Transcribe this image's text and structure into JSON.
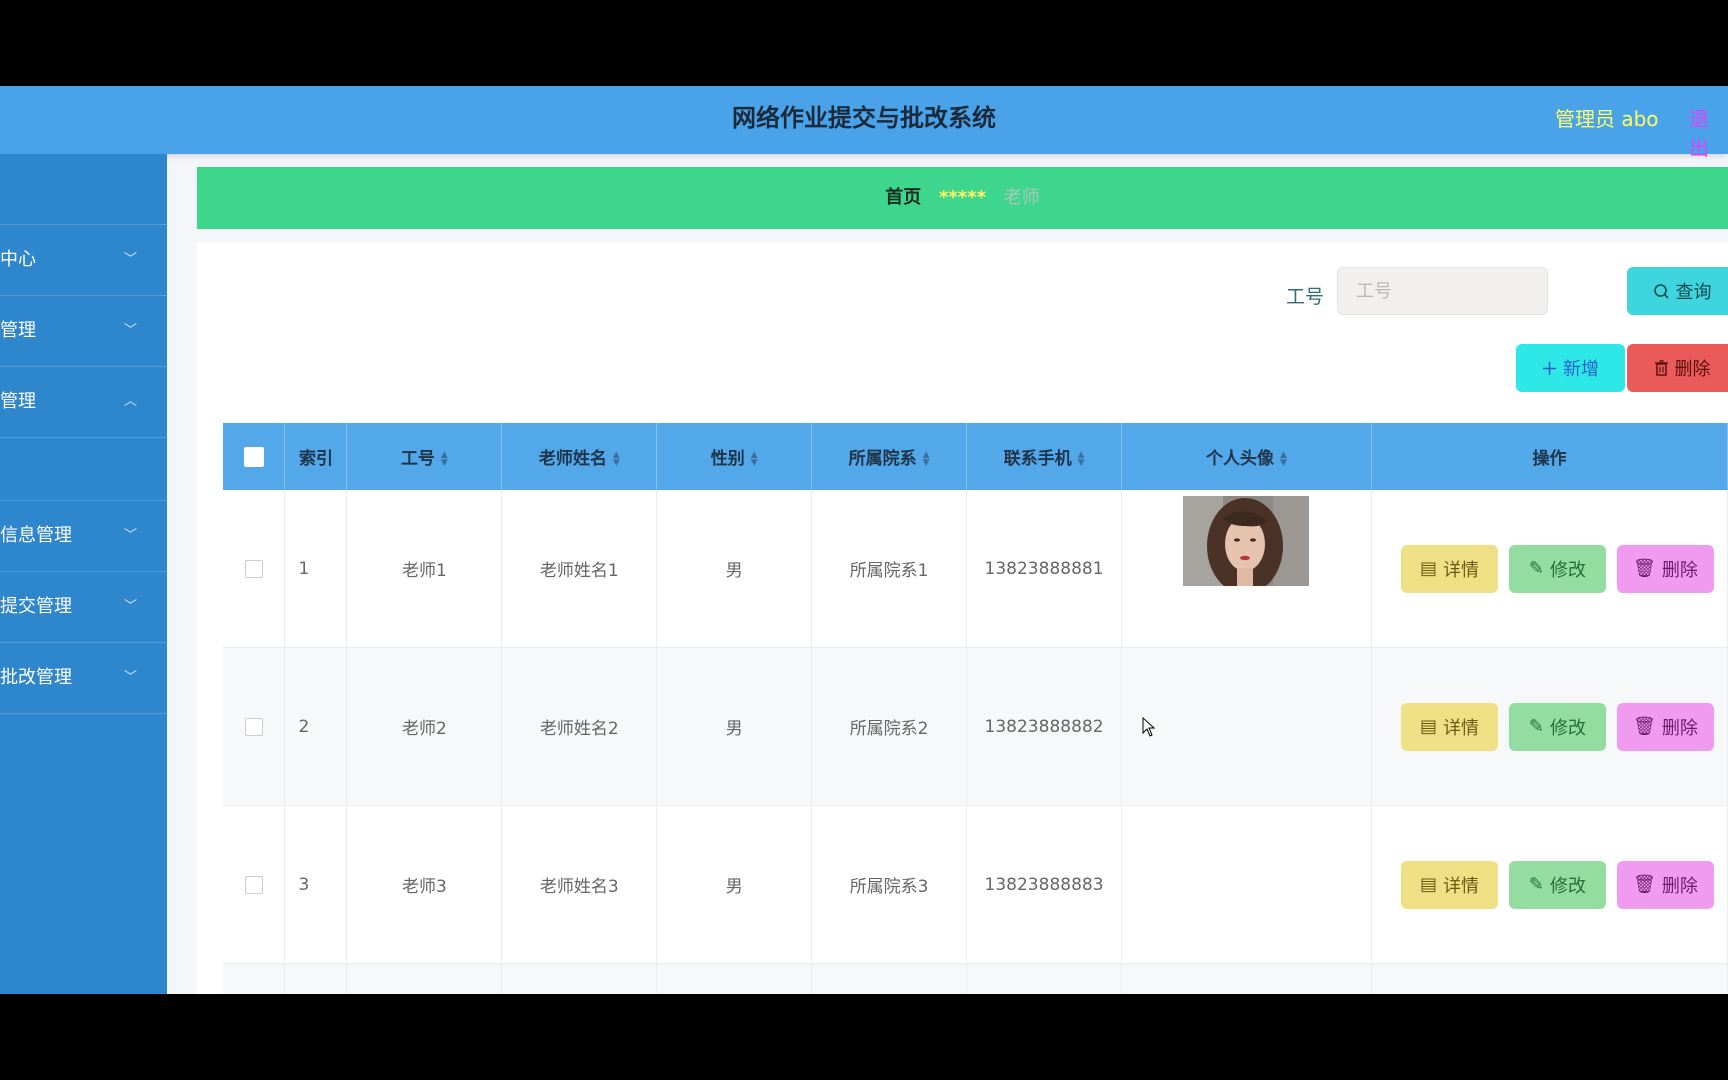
{
  "header": {
    "title": "网络作业提交与批改系统",
    "user": "管理员 abo",
    "logout": "退出"
  },
  "sidebar": {
    "top": "",
    "items": [
      {
        "label": "中心",
        "chevron": "﹀"
      },
      {
        "label": "管理",
        "chevron": "﹀"
      },
      {
        "label": "管理",
        "chevron": "︿"
      },
      {
        "label": "信息管理",
        "chevron": "﹀"
      },
      {
        "label": "提交管理",
        "chevron": "﹀"
      },
      {
        "label": "批改管理",
        "chevron": "﹀"
      }
    ]
  },
  "breadcrumb": {
    "home": "首页",
    "separator": "*****",
    "current": "老师"
  },
  "search": {
    "label": "工号",
    "placeholder": "工号",
    "button": "查询"
  },
  "actions": {
    "add": "新增",
    "delete": "删除"
  },
  "table": {
    "columns": [
      "索引",
      "工号",
      "老师姓名",
      "性别",
      "所属院系",
      "联系手机",
      "个人头像",
      "操作"
    ],
    "rows": [
      {
        "index": "1",
        "id": "老师1",
        "name": "老师姓名1",
        "gender": "男",
        "dept": "所属院系1",
        "phone": "13823888881"
      },
      {
        "index": "2",
        "id": "老师2",
        "name": "老师姓名2",
        "gender": "男",
        "dept": "所属院系2",
        "phone": "13823888882"
      },
      {
        "index": "3",
        "id": "老师3",
        "name": "老师姓名3",
        "gender": "男",
        "dept": "所属院系3",
        "phone": "13823888883"
      }
    ],
    "row_actions": {
      "detail": "详情",
      "edit": "修改",
      "remove": "删除"
    }
  }
}
